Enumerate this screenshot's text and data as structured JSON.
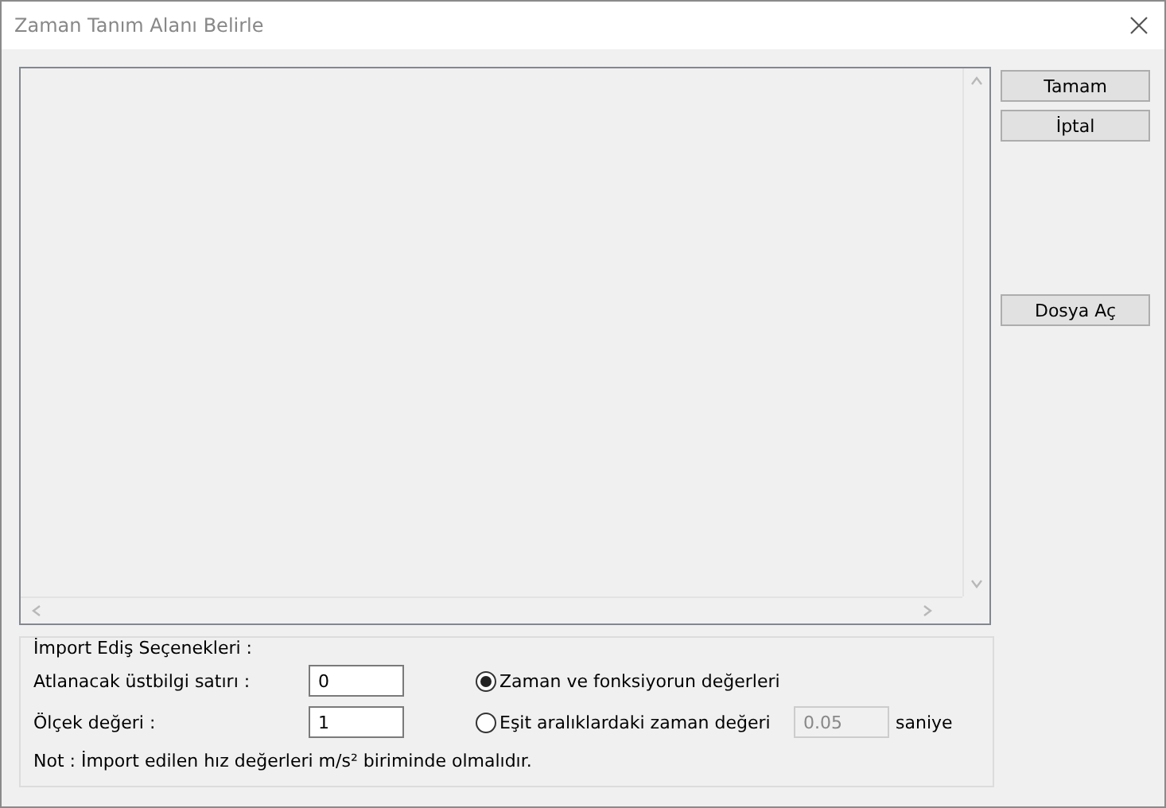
{
  "window": {
    "title": "Zaman Tanım Alanı Belirle"
  },
  "buttons": [
    "Tamam",
    "İptal"
  ],
  "file_button": "Dosya Aç",
  "import_options": {
    "title": "İmport Ediş Seçenekleri :",
    "fields": [
      {
        "label": "Atlanacak üstbilgi satırı :",
        "value": "0"
      },
      {
        "label": "Ölçek değeri :",
        "value": "1"
      }
    ],
    "radios": [
      {
        "label": "Zaman ve fonksiyorun değerleri",
        "selected": true
      },
      {
        "label": "Eşit aralıklardaki zaman değeri",
        "selected": false,
        "field": {
          "value": "0.05",
          "disabled": true
        },
        "unit": "saniye"
      }
    ],
    "note": "Not : İmport edilen hız değerleri m/s² biriminde olmalıdır."
  }
}
